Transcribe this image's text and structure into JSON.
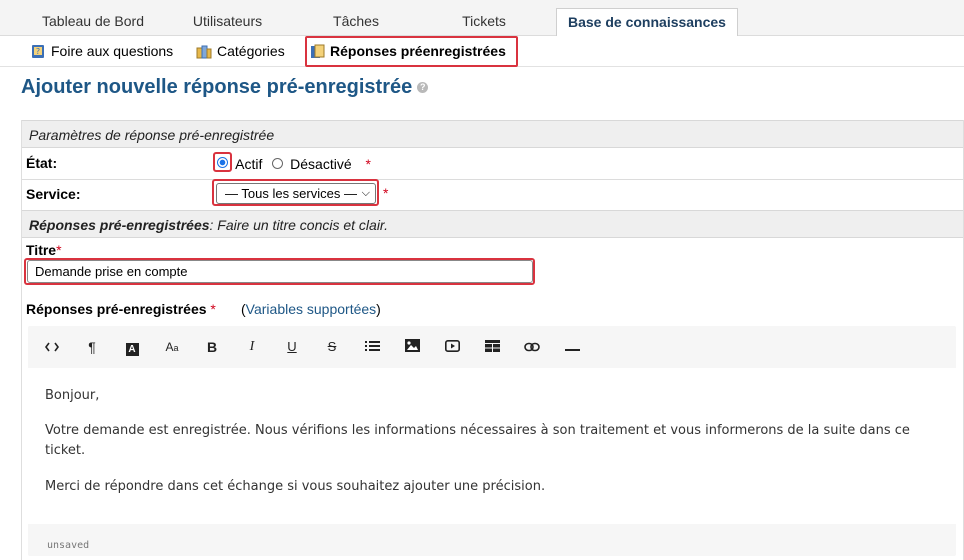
{
  "tabs": [
    "Tableau de Bord",
    "Utilisateurs",
    "Tâches",
    "Tickets",
    "Base de connaissances"
  ],
  "subnav": {
    "faq": "Foire aux questions",
    "categories": "Catégories",
    "canned": "Réponses préenregistrées"
  },
  "page": {
    "title": "Ajouter nouvelle réponse pré-enregistrée",
    "help": "?"
  },
  "settings": {
    "header": "Paramètres de réponse pré-enregistrée",
    "state_label": "État:",
    "state_active": "Actif",
    "state_disabled": "Désactivé",
    "service_label": "Service:",
    "service_value": "— Tous les services —",
    "required_mark": "*"
  },
  "responses_section": {
    "header_bold": "Réponses pré-enregistrées",
    "header_rest": ": Faire un titre concis et clair.",
    "title_label": "Titre",
    "title_value": "Demande prise en compte",
    "body_label": "Réponses pré-enregistrées",
    "vars_open": "(",
    "vars_link": "Variables supportées",
    "vars_close": ")"
  },
  "editor": {
    "toolbar": [
      "code-view",
      "paragraph",
      "font-color",
      "font-size",
      "bold",
      "italic",
      "underline",
      "strikethrough",
      "list",
      "image",
      "video",
      "table",
      "link",
      "horizontal-rule"
    ],
    "lines": [
      "Bonjour,",
      "Votre demande est enregistrée. Nous vérifions les informations nécessaires à son traitement et vous informerons de la suite dans ce ticket.",
      "Merci de répondre dans cet échange si vous souhaitez ajouter une précision."
    ],
    "status": "unsaved"
  },
  "colors": {
    "highlight": "#d9333f",
    "link": "#1e5786",
    "required": "#d0021b"
  }
}
